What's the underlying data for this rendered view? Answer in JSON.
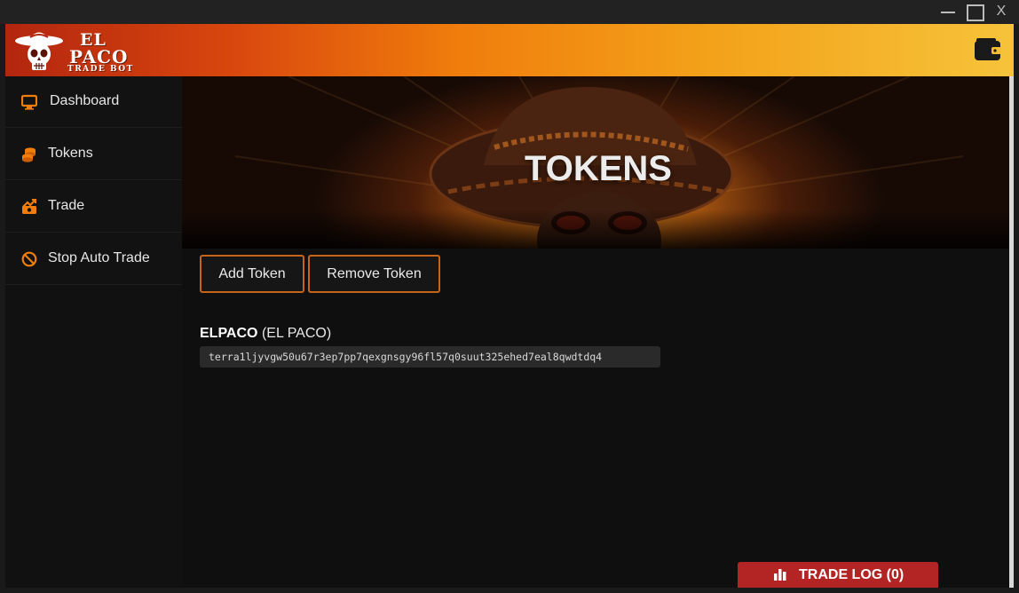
{
  "window": {
    "close_label": "X"
  },
  "header": {
    "logo": {
      "line1": "EL",
      "line2": "PACO",
      "line3": "TRADE BOT"
    },
    "wallet_icon": "wallet-icon"
  },
  "sidebar": {
    "items": [
      {
        "label": "Dashboard",
        "icon": "monitor-icon"
      },
      {
        "label": "Tokens",
        "icon": "coins-icon"
      },
      {
        "label": "Trade",
        "icon": "trade-chart-icon"
      },
      {
        "label": "Stop Auto Trade",
        "icon": "ban-icon"
      }
    ]
  },
  "main": {
    "banner_title": "TOKENS",
    "buttons": {
      "add": "Add Token",
      "remove": "Remove Token"
    },
    "token": {
      "symbol": "ELPACO",
      "name": "(EL PACO)",
      "address": "terra1ljyvgw50u67r3ep7pp7qexgnsgy96fl57q0suut325ehed7eal8qwdtdq4"
    }
  },
  "trade_log": {
    "label": "TRADE LOG (0)"
  },
  "colors": {
    "accent": "#f07d0c",
    "button_border": "#c4651a",
    "trade_log": "#b32424"
  }
}
